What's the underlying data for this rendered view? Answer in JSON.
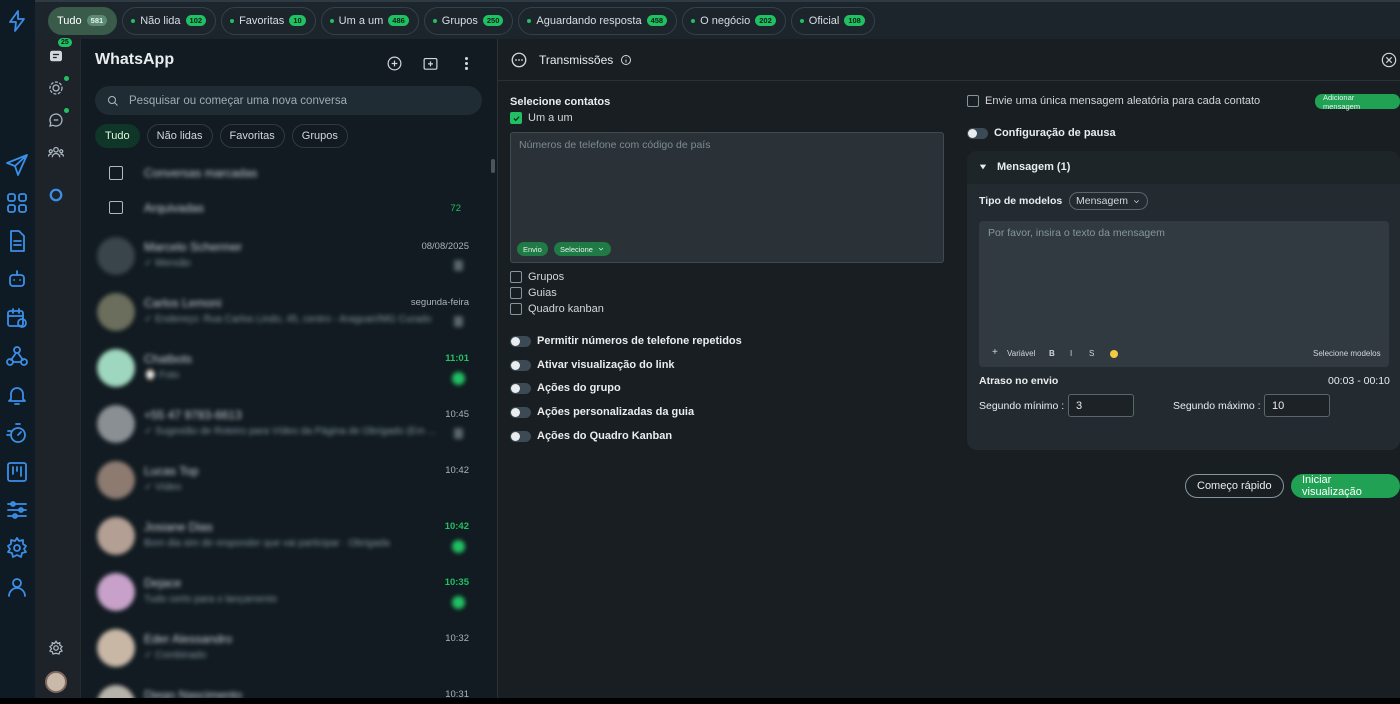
{
  "filters": [
    {
      "label": "Tudo",
      "count": "581",
      "active": true
    },
    {
      "label": "Não lida",
      "count": "102"
    },
    {
      "label": "Favoritas",
      "count": "10"
    },
    {
      "label": "Um a um",
      "count": "486"
    },
    {
      "label": "Grupos",
      "count": "250"
    },
    {
      "label": "Aguardando resposta",
      "count": "458"
    },
    {
      "label": "O negócio",
      "count": "202"
    },
    {
      "label": "Oficial",
      "count": "108"
    }
  ],
  "rail": {
    "chats_badge": "25"
  },
  "chat": {
    "title": "WhatsApp",
    "search_placeholder": "Pesquisar ou começar uma nova conversa",
    "tabs": [
      "Tudo",
      "Não lidas",
      "Favoritas",
      "Grupos"
    ],
    "marked": "Conversas marcadas",
    "archived": "Arquivadas",
    "archived_count": "72",
    "rows": [
      {
        "name": "Marcelo Schermer",
        "preview": "✓ Mensão",
        "time": "08/08/2025"
      },
      {
        "name": "Carlos Lemoni",
        "preview": "✓ Endereço: Rua Carlos Lindo, 45, centro - Araguari/MG Curado",
        "time": "segunda-feira"
      },
      {
        "name": "Chatbots",
        "preview": "⌚ Foto",
        "time": "11:01"
      },
      {
        "name": "+55 47 9783-6613",
        "preview": "✓ Sugestão de Roteiro para Vídeo da Página de Obrigado (Em ...",
        "time": "10:45"
      },
      {
        "name": "Lucas Top",
        "preview": "✓ Vídeo",
        "time": "10:42"
      },
      {
        "name": "Josiane Dias",
        "preview": "Bom dia sim de responder que vai participar · Obrigada",
        "time": "10:42"
      },
      {
        "name": "Dejace",
        "preview": "Tudo certo para o lançamento",
        "time": "10:35"
      },
      {
        "name": "Eder Alessandro",
        "preview": "✓ Combinado",
        "time": "10:32"
      },
      {
        "name": "Diego Nascimento",
        "preview": "",
        "time": "10:31"
      }
    ]
  },
  "broadcast": {
    "title": "Transmissões",
    "select_contacts": "Selecione contatos",
    "one_to_one": "Um a um",
    "phone_placeholder": "Números de telefone com código de país",
    "send_btn": "Envio",
    "select_btn": "Selecione",
    "groups": "Grupos",
    "guides": "Guias",
    "kanban": "Quadro kanban",
    "toggles": [
      "Permitir números de telefone repetidos",
      "Ativar visualização do link",
      "Ações do grupo",
      "Ações personalizadas da guia",
      "Ações do Quadro Kanban"
    ],
    "random_msg": "Envie uma única mensagem aleatória para cada contato",
    "add_message": "Adicionar mensagem",
    "pause_config": "Configuração de pausa",
    "message_header": "Mensagem (1)",
    "template_type": "Tipo de modelos",
    "template_value": "Mensagem",
    "msg_placeholder": "Por favor, insira o texto da mensagem",
    "variable": "Variável",
    "bold": "B",
    "italic": "I",
    "strike": "S",
    "select_models": "Selecione modelos",
    "delay_label": "Atraso no envio",
    "delay_range": "00:03 - 00:10",
    "min_label": "Segundo mínimo :",
    "min_value": "3",
    "max_label": "Segundo máximo :",
    "max_value": "10",
    "quick_start": "Começo rápido",
    "start_preview": "Iniciar visualização"
  },
  "colors": {
    "accent": "#21c063",
    "rail_icon": "#3b8fe8",
    "bg": "#111b21"
  }
}
